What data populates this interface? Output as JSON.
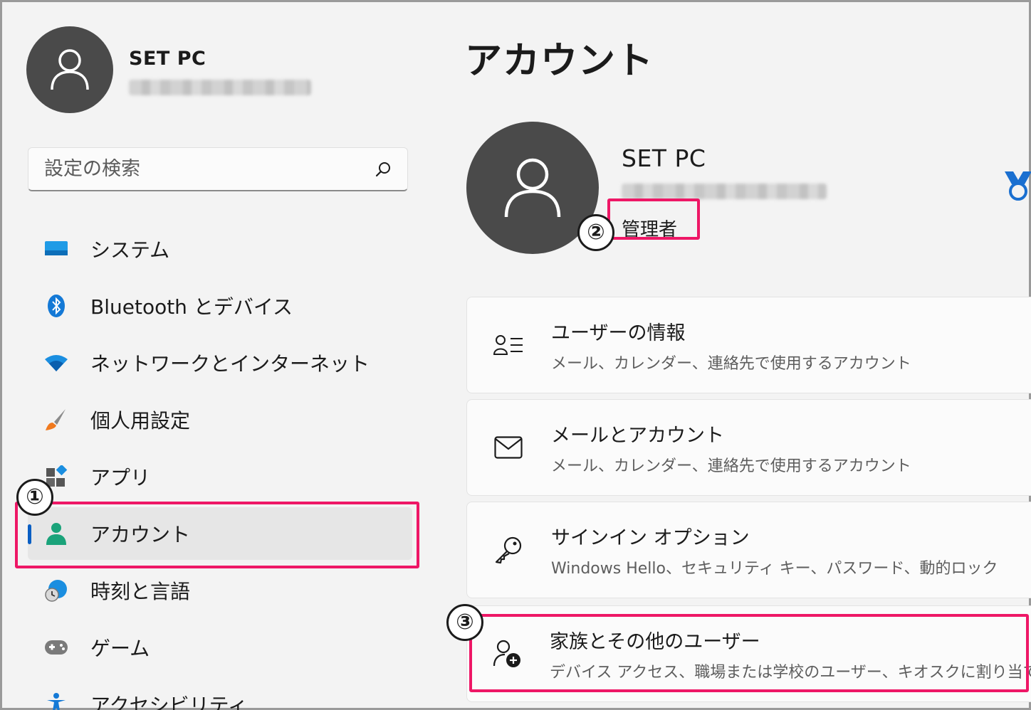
{
  "sidebar": {
    "profile": {
      "name": "SET PC"
    },
    "search": {
      "placeholder": "設定の検索"
    },
    "items": [
      {
        "label": "システム",
        "icon": "monitor-icon"
      },
      {
        "label": "Bluetooth とデバイス",
        "icon": "bluetooth-icon"
      },
      {
        "label": "ネットワークとインターネット",
        "icon": "wifi-icon"
      },
      {
        "label": "個人用設定",
        "icon": "brush-icon"
      },
      {
        "label": "アプリ",
        "icon": "apps-icon"
      },
      {
        "label": "アカウント",
        "icon": "person-icon",
        "active": true
      },
      {
        "label": "時刻と言語",
        "icon": "globe-clock-icon"
      },
      {
        "label": "ゲーム",
        "icon": "gamepad-icon"
      },
      {
        "label": "アクセシビリティ",
        "icon": "accessibility-icon"
      }
    ]
  },
  "main": {
    "title": "アカウント",
    "profile": {
      "name": "SET PC",
      "role": "管理者"
    },
    "cards": [
      {
        "title": "ユーザーの情報",
        "subtitle": "メール、カレンダー、連絡先で使用するアカウント",
        "icon": "person-list-icon"
      },
      {
        "title": "メールとアカウント",
        "subtitle": "メール、カレンダー、連絡先で使用するアカウント",
        "icon": "mail-icon"
      },
      {
        "title": "サインイン オプション",
        "subtitle": "Windows Hello、セキュリティ キー、パスワード、動的ロック",
        "icon": "key-icon"
      },
      {
        "title": "家族とその他のユーザー",
        "subtitle": "デバイス アクセス、職場または学校のユーザー、キオスクに割り当てられたア",
        "icon": "person-add-icon"
      }
    ]
  },
  "annotations": {
    "badge1": "①",
    "badge2": "②",
    "badge3": "③"
  },
  "colors": {
    "accent": "#0a5fc4",
    "highlight": "#ee1766",
    "avatar": "#4a4a4a",
    "background": "#f3f3f3"
  }
}
